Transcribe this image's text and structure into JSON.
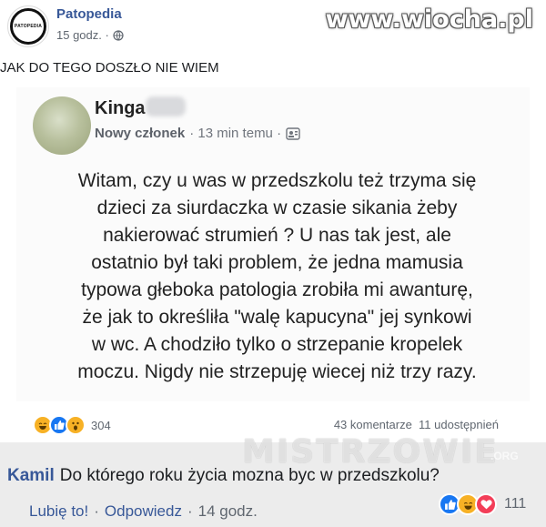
{
  "header": {
    "logo_text": "PATOPEDIA",
    "page_name": "Patopedia",
    "time": "15 godz. ·",
    "watermark": "www.wiocha.pl"
  },
  "caption": "JAK DO TEGO DOSZŁO NIE WIEM",
  "screenshot": {
    "author": "Kinga",
    "role": "Nowy członek",
    "time": "· 13 min temu ·",
    "lines": [
      "Witam, czy u was w przedszkolu też trzyma się",
      "dzieci za siurdaczka w czasie sikania żeby",
      "nakierować strumień ? U nas tak jest, ale",
      "ostatnio był taki problem, że jedna mamusia",
      "typowa głeboka patologia zrobiła mi awanturę,",
      "że jak to określiła \"walę kapucyna\" jej synkowi",
      "w wc. A chodziło tylko o strzepanie kropelek",
      "moczu. Nigdy nie strzepuję wiecej niż trzy razy."
    ]
  },
  "stats": {
    "reaction_icons": [
      "haha-icon",
      "like-icon",
      "wow-icon"
    ],
    "reaction_count": "304",
    "comments": "43 komentarze",
    "shares": "11 udostępnień"
  },
  "watermark2": {
    "text": "MISTRZOWIE",
    "suffix": ".ORG"
  },
  "comment": {
    "author": "Kamil",
    "text": "Do którego roku życia mozna byc w przedszkolu?",
    "like": "Lubię to!",
    "reply": "Odpowiedz",
    "time": "14 godz.",
    "reaction_icons": [
      "like-icon",
      "haha-icon",
      "love-icon"
    ],
    "reaction_count": "111"
  },
  "colors": {
    "link": "#385898",
    "like": "#1877f2",
    "haha": "#f7b125",
    "love": "#f33e58"
  }
}
